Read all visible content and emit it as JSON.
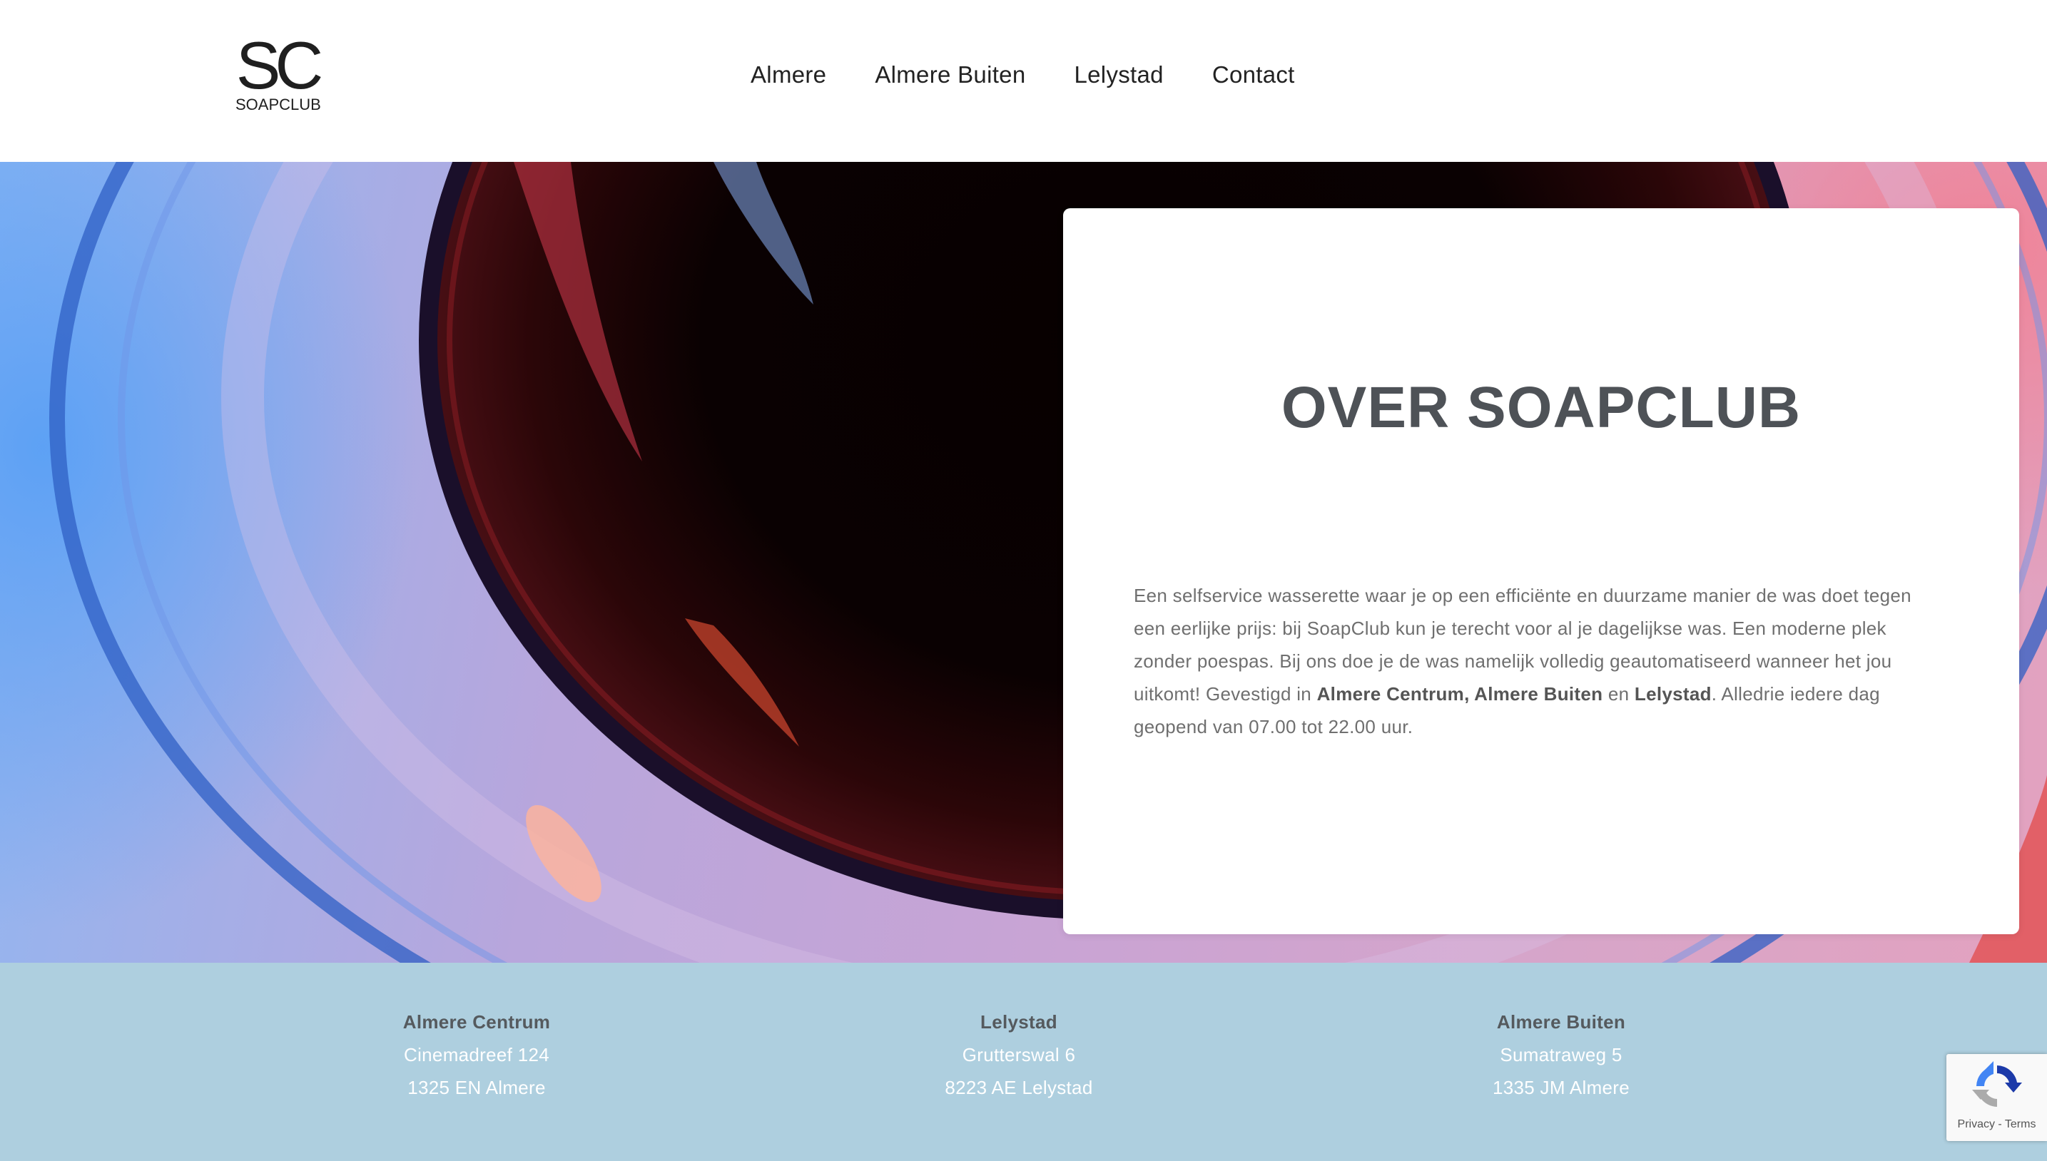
{
  "header": {
    "logo": {
      "mark": "SC",
      "text": "SOAPCLUB"
    },
    "nav": [
      "Almere",
      "Almere Buiten",
      "Lelystad",
      "Contact"
    ]
  },
  "about": {
    "title": "OVER SOAPCLUB",
    "body_intro": "Een selfservice wasserette waar je op een efficiënte en duurzame manier de was doet tegen een eerlijke prijs: bij SoapClub kun je terecht voor al je dagelijkse was. Een moderne plek zonder poespas. Bij ons doe je de was namelijk volledig geautomatiseerd wanneer het jou uitkomt! Gevestigd in ",
    "body_bold_1": "Almere Centrum, Almere Buiten",
    "body_and": " en ",
    "body_bold_2": "Lelystad",
    "body_outro": ". Alledrie iedere dag geopend van 07.00 tot 22.00 uur."
  },
  "footer": {
    "locations": [
      {
        "name": "Almere Centrum",
        "street": "Cinemadreef 124",
        "city": "1325 EN Almere"
      },
      {
        "name": "Lelystad",
        "street": "Grutterswal 6",
        "city": "8223 AE Lelystad"
      },
      {
        "name": "Almere Buiten",
        "street": "Sumatraweg 5",
        "city": "1335 JM Almere"
      }
    ]
  },
  "recaptcha": {
    "privacy": "Privacy",
    "separator": " - ",
    "terms": "Terms"
  },
  "colors": {
    "footer_bg": "#aecfdf",
    "title": "#4e5257",
    "body_text": "#6f6f6f"
  }
}
